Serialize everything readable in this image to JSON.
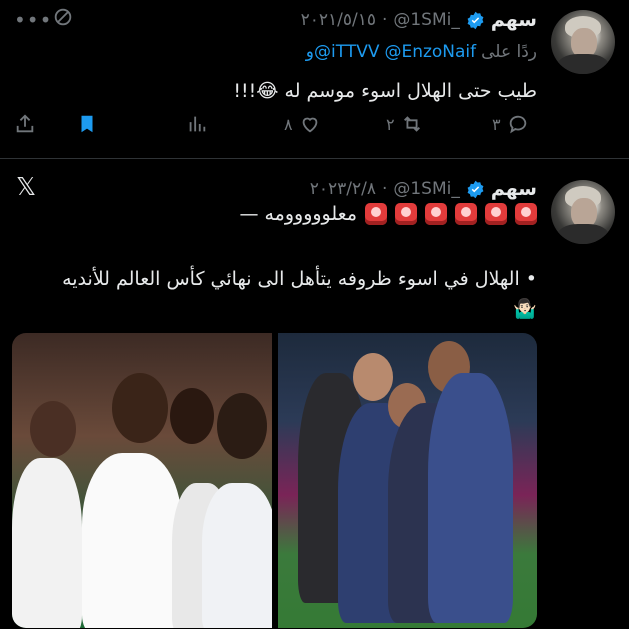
{
  "tweets": [
    {
      "name": "سهم",
      "handle": "@1SMi_",
      "date": "٢٠٢١/٥/١٥",
      "reply_prefix": "ردًا على",
      "reply_to": [
        "@EnzoNaif",
        "و@iTTVV"
      ],
      "text": "طيب حتى الهلال اسوء موسم له 😂!!!",
      "actions": {
        "reply_count": "٣",
        "retweet_count": "٢",
        "like_count": "٨"
      }
    },
    {
      "name": "سهم",
      "handle": "@1SMi_",
      "date": "٢٠٢٣/٢/٨",
      "emoji_text": "— معلووووومه",
      "body_line1": "• الهلال في اسوء ظروفه يتأهل الى نهائي كأس العالم للأنديه",
      "body_emoji": "🤷🏻‍♂️"
    }
  ],
  "icons": {
    "verified": "verified-badge-icon",
    "reply": "reply-icon",
    "retweet": "retweet-icon",
    "like": "heart-icon",
    "views": "analytics-icon",
    "bookmark": "bookmark-icon",
    "share": "share-icon",
    "more": "more-dots-icon",
    "x_logo": "x-logo-icon"
  },
  "colors": {
    "background": "#000000",
    "text": "#e7e9ea",
    "muted": "#71767b",
    "link": "#1d9bf0",
    "bookmark_active": "#1d9bf0"
  },
  "x_logo_glyph": "𝕏",
  "more_glyph": "•••"
}
